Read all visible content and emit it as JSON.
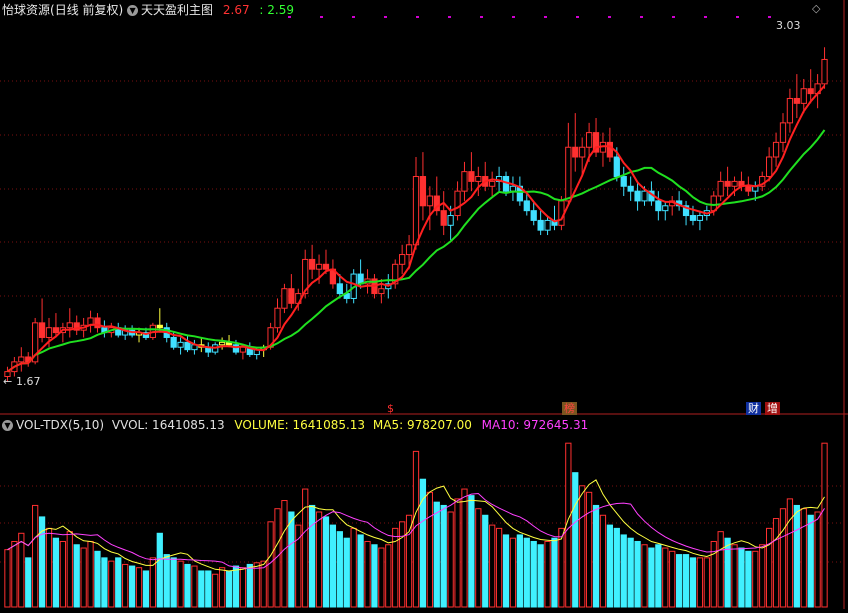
{
  "header": {
    "stock_name": "怡球资源",
    "period": "(日线 前复权)",
    "indicator": "天天盈利主图",
    "value1": "2.67",
    "value2": ": 2.59",
    "color_red": "#ff3232",
    "color_green": "#32ff32"
  },
  "price_panel": {
    "high_label": "3.03",
    "low_label": "1.67",
    "ylim": [
      1.6,
      3.15
    ],
    "badges": [
      {
        "text": "$",
        "color": "#ff3030",
        "bg": "transparent"
      },
      {
        "text": "榜",
        "color": "#ff4040",
        "bg": "#7a5520"
      },
      {
        "text": "财",
        "color": "#ffffff",
        "bg": "#1030a0"
      },
      {
        "text": "增",
        "color": "#ffffff",
        "bg": "#a01010"
      }
    ]
  },
  "volume_panel": {
    "title": "VOL-TDX(5,10)",
    "vvol_label": "VVOL: 1641085.13",
    "volume_label": "VOLUME: 1641085.13",
    "ma5_label": "MA5: 978207.00",
    "ma10_label": "MA10: 972645.31",
    "colors": {
      "white": "#e0e0e0",
      "yellow": "#ffff40",
      "magenta": "#ff40ff"
    }
  },
  "chart_data": {
    "type": "candlestick",
    "candles": [
      [
        1.68,
        1.72,
        1.66,
        1.7,
        0.35
      ],
      [
        1.7,
        1.76,
        1.68,
        1.74,
        0.4
      ],
      [
        1.74,
        1.8,
        1.7,
        1.76,
        0.45
      ],
      [
        1.76,
        1.78,
        1.72,
        1.74,
        0.3
      ],
      [
        1.74,
        1.92,
        1.73,
        1.9,
        0.62
      ],
      [
        1.9,
        2.0,
        1.82,
        1.84,
        0.55
      ],
      [
        1.84,
        1.92,
        1.8,
        1.88,
        0.48
      ],
      [
        1.88,
        1.94,
        1.84,
        1.86,
        0.42
      ],
      [
        1.86,
        1.9,
        1.82,
        1.88,
        0.4
      ],
      [
        1.88,
        1.96,
        1.84,
        1.9,
        0.46
      ],
      [
        1.9,
        1.93,
        1.85,
        1.87,
        0.38
      ],
      [
        1.87,
        1.92,
        1.84,
        1.89,
        0.36
      ],
      [
        1.89,
        1.95,
        1.86,
        1.92,
        0.4
      ],
      [
        1.92,
        1.94,
        1.86,
        1.88,
        0.34
      ],
      [
        1.88,
        1.91,
        1.84,
        1.86,
        0.3
      ],
      [
        1.86,
        1.9,
        1.84,
        1.88,
        0.28
      ],
      [
        1.88,
        1.9,
        1.84,
        1.85,
        0.3
      ],
      [
        1.85,
        1.89,
        1.83,
        1.87,
        0.26
      ],
      [
        1.87,
        1.89,
        1.84,
        1.85,
        0.25
      ],
      [
        1.85,
        1.88,
        1.82,
        1.86,
        0.24
      ],
      [
        1.86,
        1.88,
        1.83,
        1.84,
        0.22
      ],
      [
        1.84,
        1.9,
        1.83,
        1.89,
        0.3
      ],
      [
        1.89,
        1.96,
        1.86,
        1.88,
        0.45
      ],
      [
        1.88,
        1.9,
        1.82,
        1.84,
        0.32
      ],
      [
        1.84,
        1.86,
        1.79,
        1.8,
        0.3
      ],
      [
        1.8,
        1.84,
        1.77,
        1.82,
        0.28
      ],
      [
        1.82,
        1.85,
        1.78,
        1.79,
        0.26
      ],
      [
        1.79,
        1.83,
        1.77,
        1.81,
        0.25
      ],
      [
        1.81,
        1.84,
        1.78,
        1.8,
        0.22
      ],
      [
        1.8,
        1.82,
        1.76,
        1.78,
        0.22
      ],
      [
        1.78,
        1.82,
        1.77,
        1.81,
        0.2
      ],
      [
        1.81,
        1.84,
        1.79,
        1.82,
        0.24
      ],
      [
        1.82,
        1.85,
        1.8,
        1.81,
        0.22
      ],
      [
        1.81,
        1.83,
        1.77,
        1.78,
        0.25
      ],
      [
        1.78,
        1.81,
        1.75,
        1.8,
        0.24
      ],
      [
        1.8,
        1.82,
        1.76,
        1.77,
        0.26
      ],
      [
        1.77,
        1.8,
        1.75,
        1.79,
        0.27
      ],
      [
        1.79,
        1.81,
        1.76,
        1.8,
        0.28
      ],
      [
        1.8,
        1.9,
        1.79,
        1.88,
        0.52
      ],
      [
        1.88,
        2.0,
        1.86,
        1.96,
        0.6
      ],
      [
        1.96,
        2.06,
        1.94,
        2.04,
        0.65
      ],
      [
        2.04,
        2.1,
        1.96,
        1.98,
        0.58
      ],
      [
        1.98,
        2.04,
        1.95,
        2.02,
        0.5
      ],
      [
        2.02,
        2.2,
        2.0,
        2.16,
        0.72
      ],
      [
        2.16,
        2.22,
        2.08,
        2.12,
        0.62
      ],
      [
        2.12,
        2.18,
        2.06,
        2.14,
        0.58
      ],
      [
        2.14,
        2.2,
        2.1,
        2.12,
        0.55
      ],
      [
        2.12,
        2.16,
        2.04,
        2.06,
        0.5
      ],
      [
        2.06,
        2.1,
        2.0,
        2.02,
        0.46
      ],
      [
        2.02,
        2.06,
        1.98,
        2.0,
        0.42
      ],
      [
        2.0,
        2.12,
        1.98,
        2.1,
        0.48
      ],
      [
        2.1,
        2.16,
        2.04,
        2.06,
        0.44
      ],
      [
        2.06,
        2.12,
        2.02,
        2.08,
        0.4
      ],
      [
        2.08,
        2.1,
        2.0,
        2.02,
        0.38
      ],
      [
        2.02,
        2.08,
        1.98,
        2.04,
        0.36
      ],
      [
        2.04,
        2.1,
        2.0,
        2.06,
        0.38
      ],
      [
        2.06,
        2.16,
        2.04,
        2.14,
        0.48
      ],
      [
        2.14,
        2.22,
        2.1,
        2.18,
        0.52
      ],
      [
        2.18,
        2.26,
        2.12,
        2.22,
        0.56
      ],
      [
        2.22,
        2.58,
        2.2,
        2.5,
        0.95
      ],
      [
        2.5,
        2.6,
        2.32,
        2.38,
        0.78
      ],
      [
        2.38,
        2.46,
        2.28,
        2.42,
        0.7
      ],
      [
        2.42,
        2.5,
        2.34,
        2.36,
        0.64
      ],
      [
        2.36,
        2.44,
        2.26,
        2.3,
        0.62
      ],
      [
        2.3,
        2.38,
        2.24,
        2.34,
        0.58
      ],
      [
        2.34,
        2.48,
        2.32,
        2.44,
        0.66
      ],
      [
        2.44,
        2.56,
        2.4,
        2.52,
        0.72
      ],
      [
        2.52,
        2.6,
        2.44,
        2.48,
        0.68
      ],
      [
        2.48,
        2.54,
        2.42,
        2.5,
        0.6
      ],
      [
        2.5,
        2.56,
        2.44,
        2.46,
        0.56
      ],
      [
        2.46,
        2.52,
        2.42,
        2.48,
        0.5
      ],
      [
        2.48,
        2.54,
        2.44,
        2.5,
        0.48
      ],
      [
        2.5,
        2.52,
        2.42,
        2.44,
        0.44
      ],
      [
        2.44,
        2.5,
        2.4,
        2.46,
        0.42
      ],
      [
        2.46,
        2.5,
        2.38,
        2.4,
        0.44
      ],
      [
        2.4,
        2.44,
        2.34,
        2.36,
        0.42
      ],
      [
        2.36,
        2.4,
        2.3,
        2.32,
        0.4
      ],
      [
        2.32,
        2.36,
        2.26,
        2.28,
        0.38
      ],
      [
        2.28,
        2.34,
        2.26,
        2.32,
        0.4
      ],
      [
        2.32,
        2.38,
        2.28,
        2.3,
        0.42
      ],
      [
        2.3,
        2.42,
        2.28,
        2.4,
        0.48
      ],
      [
        2.4,
        2.72,
        2.38,
        2.62,
        1.0
      ],
      [
        2.62,
        2.76,
        2.52,
        2.58,
        0.82
      ],
      [
        2.58,
        2.66,
        2.5,
        2.62,
        0.74
      ],
      [
        2.62,
        2.72,
        2.56,
        2.68,
        0.7
      ],
      [
        2.68,
        2.74,
        2.58,
        2.6,
        0.62
      ],
      [
        2.6,
        2.68,
        2.54,
        2.64,
        0.56
      ],
      [
        2.64,
        2.7,
        2.56,
        2.58,
        0.5
      ],
      [
        2.58,
        2.62,
        2.48,
        2.5,
        0.48
      ],
      [
        2.5,
        2.54,
        2.42,
        2.46,
        0.44
      ],
      [
        2.46,
        2.5,
        2.4,
        2.44,
        0.42
      ],
      [
        2.44,
        2.48,
        2.36,
        2.4,
        0.4
      ],
      [
        2.4,
        2.46,
        2.38,
        2.44,
        0.38
      ],
      [
        2.44,
        2.48,
        2.38,
        2.4,
        0.36
      ],
      [
        2.4,
        2.44,
        2.32,
        2.36,
        0.38
      ],
      [
        2.36,
        2.4,
        2.32,
        2.38,
        0.36
      ],
      [
        2.38,
        2.42,
        2.34,
        2.4,
        0.34
      ],
      [
        2.4,
        2.44,
        2.36,
        2.38,
        0.32
      ],
      [
        2.38,
        2.4,
        2.3,
        2.34,
        0.32
      ],
      [
        2.34,
        2.38,
        2.3,
        2.32,
        0.3
      ],
      [
        2.32,
        2.36,
        2.28,
        2.34,
        0.3
      ],
      [
        2.34,
        2.38,
        2.32,
        2.36,
        0.3
      ],
      [
        2.36,
        2.44,
        2.34,
        2.42,
        0.4
      ],
      [
        2.42,
        2.52,
        2.4,
        2.48,
        0.46
      ],
      [
        2.48,
        2.54,
        2.42,
        2.46,
        0.42
      ],
      [
        2.46,
        2.5,
        2.42,
        2.48,
        0.38
      ],
      [
        2.48,
        2.52,
        2.44,
        2.46,
        0.36
      ],
      [
        2.46,
        2.5,
        2.42,
        2.44,
        0.34
      ],
      [
        2.44,
        2.48,
        2.4,
        2.46,
        0.34
      ],
      [
        2.46,
        2.52,
        2.44,
        2.5,
        0.38
      ],
      [
        2.5,
        2.62,
        2.48,
        2.58,
        0.48
      ],
      [
        2.58,
        2.68,
        2.54,
        2.64,
        0.54
      ],
      [
        2.64,
        2.76,
        2.6,
        2.72,
        0.6
      ],
      [
        2.72,
        2.86,
        2.68,
        2.82,
        0.66
      ],
      [
        2.82,
        2.92,
        2.74,
        2.8,
        0.62
      ],
      [
        2.8,
        2.9,
        2.76,
        2.86,
        0.6
      ],
      [
        2.86,
        2.94,
        2.8,
        2.84,
        0.56
      ],
      [
        2.84,
        2.92,
        2.78,
        2.88,
        0.58
      ],
      [
        2.88,
        3.03,
        2.86,
        2.98,
        1.0
      ]
    ]
  }
}
